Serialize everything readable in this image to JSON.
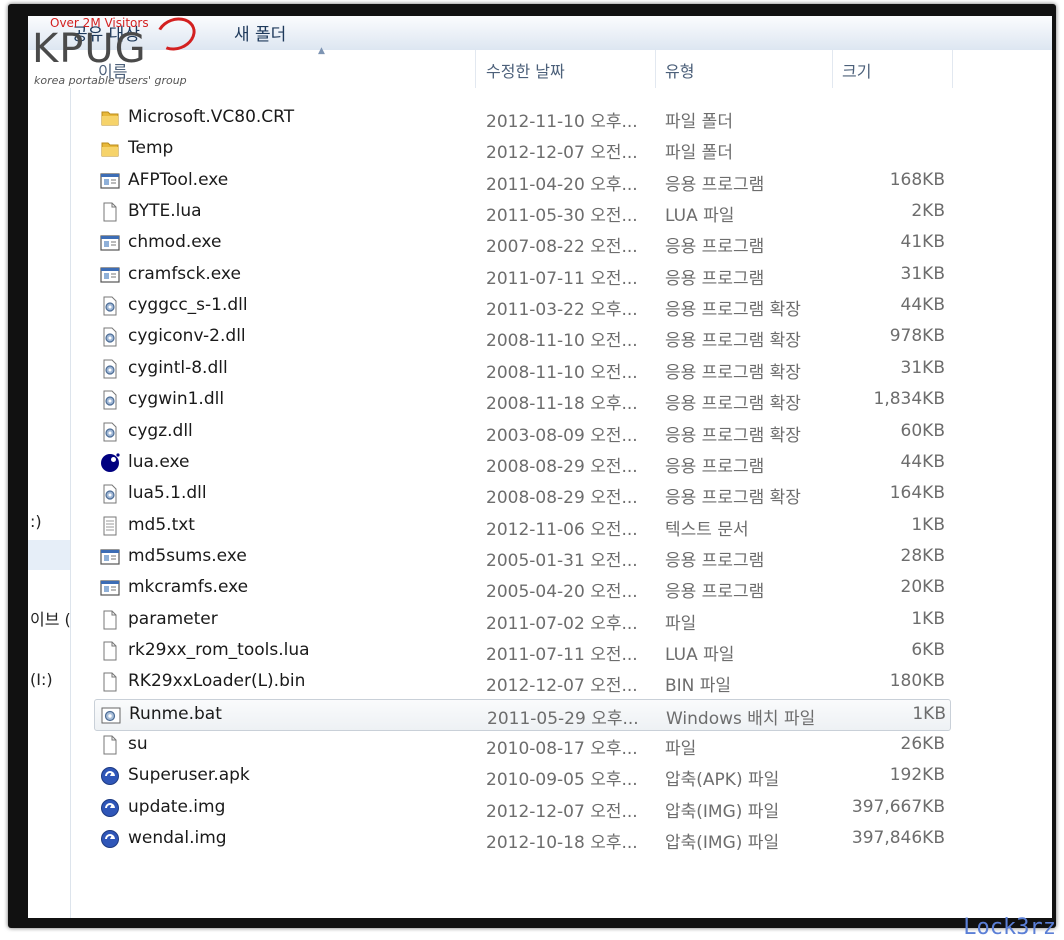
{
  "toolbar": {
    "share_label": "공유 대상",
    "new_folder_label": "새 폴더"
  },
  "columns": {
    "name": "이름",
    "date": "수정한 날짜",
    "type": "유형",
    "size": "크기"
  },
  "left_pane": [
    ":)",
    "이브 (",
    "(I:)"
  ],
  "files": [
    {
      "name": "Microsoft.VC80.CRT",
      "date": "2012-11-10 오후...",
      "type": "파일 폴더",
      "size": "",
      "icon": "folder-icon"
    },
    {
      "name": "Temp",
      "date": "2012-12-07 오전...",
      "type": "파일 폴더",
      "size": "",
      "icon": "folder-icon"
    },
    {
      "name": "AFPTool.exe",
      "date": "2011-04-20 오후...",
      "type": "응용 프로그램",
      "size": "168KB",
      "icon": "application-icon"
    },
    {
      "name": "BYTE.lua",
      "date": "2011-05-30 오전...",
      "type": "LUA 파일",
      "size": "2KB",
      "icon": "file-icon"
    },
    {
      "name": "chmod.exe",
      "date": "2007-08-22 오전...",
      "type": "응용 프로그램",
      "size": "41KB",
      "icon": "application-icon"
    },
    {
      "name": "cramfsck.exe",
      "date": "2011-07-11 오전...",
      "type": "응용 프로그램",
      "size": "31KB",
      "icon": "application-icon"
    },
    {
      "name": "cyggcc_s-1.dll",
      "date": "2011-03-22 오후...",
      "type": "응용 프로그램 확장",
      "size": "44KB",
      "icon": "dll-gear-icon"
    },
    {
      "name": "cygiconv-2.dll",
      "date": "2008-11-10 오전...",
      "type": "응용 프로그램 확장",
      "size": "978KB",
      "icon": "dll-gear-icon"
    },
    {
      "name": "cygintl-8.dll",
      "date": "2008-11-10 오전...",
      "type": "응용 프로그램 확장",
      "size": "31KB",
      "icon": "dll-gear-icon"
    },
    {
      "name": "cygwin1.dll",
      "date": "2008-11-18 오후...",
      "type": "응용 프로그램 확장",
      "size": "1,834KB",
      "icon": "dll-gear-icon"
    },
    {
      "name": "cygz.dll",
      "date": "2003-08-09 오전...",
      "type": "응용 프로그램 확장",
      "size": "60KB",
      "icon": "dll-gear-icon"
    },
    {
      "name": "lua.exe",
      "date": "2008-08-29 오전...",
      "type": "응용 프로그램",
      "size": "44KB",
      "icon": "lua-icon"
    },
    {
      "name": "lua5.1.dll",
      "date": "2008-08-29 오전...",
      "type": "응용 프로그램 확장",
      "size": "164KB",
      "icon": "dll-gear-icon"
    },
    {
      "name": "md5.txt",
      "date": "2012-11-06 오전...",
      "type": "텍스트 문서",
      "size": "1KB",
      "icon": "text-file-icon"
    },
    {
      "name": "md5sums.exe",
      "date": "2005-01-31 오전...",
      "type": "응용 프로그램",
      "size": "28KB",
      "icon": "application-icon"
    },
    {
      "name": "mkcramfs.exe",
      "date": "2005-04-20 오전...",
      "type": "응용 프로그램",
      "size": "20KB",
      "icon": "application-icon"
    },
    {
      "name": "parameter",
      "date": "2011-07-02 오후...",
      "type": "파일",
      "size": "1KB",
      "icon": "file-icon"
    },
    {
      "name": "rk29xx_rom_tools.lua",
      "date": "2011-07-11 오전...",
      "type": "LUA 파일",
      "size": "6KB",
      "icon": "file-icon"
    },
    {
      "name": "RK29xxLoader(L).bin",
      "date": "2012-12-07 오전...",
      "type": "BIN 파일",
      "size": "180KB",
      "icon": "file-icon"
    },
    {
      "name": "Runme.bat",
      "date": "2011-05-29 오후...",
      "type": "Windows 배치 파일",
      "size": "1KB",
      "icon": "batch-gear-icon",
      "selected": true
    },
    {
      "name": "su",
      "date": "2010-08-17 오후...",
      "type": "파일",
      "size": "26KB",
      "icon": "file-icon"
    },
    {
      "name": "Superuser.apk",
      "date": "2010-09-05 오후...",
      "type": "압축(APK) 파일",
      "size": "192KB",
      "icon": "archive-icon"
    },
    {
      "name": "update.img",
      "date": "2012-12-07 오전...",
      "type": "압축(IMG) 파일",
      "size": "397,667KB",
      "icon": "archive-icon"
    },
    {
      "name": "wendal.img",
      "date": "2012-10-18 오후...",
      "type": "압축(IMG) 파일",
      "size": "397,846KB",
      "icon": "archive-icon"
    }
  ],
  "logo": {
    "top": "Over 2M Visitors",
    "main": "KPUG",
    "sub": "korea portable users' group"
  },
  "watermark": "Lock3rz"
}
